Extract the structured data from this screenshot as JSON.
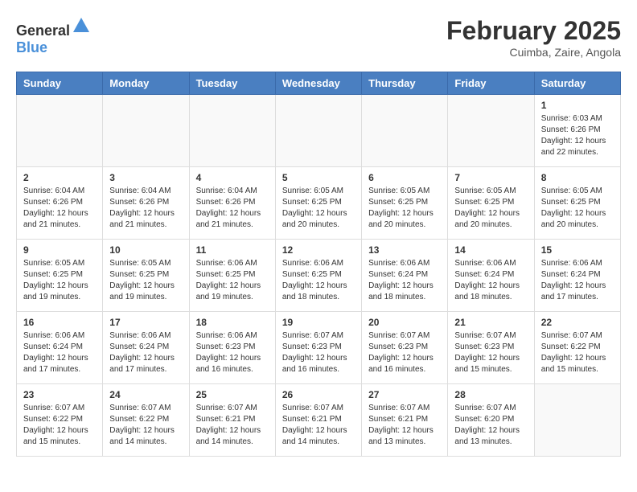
{
  "header": {
    "logo_general": "General",
    "logo_blue": "Blue",
    "month_year": "February 2025",
    "location": "Cuimba, Zaire, Angola"
  },
  "weekdays": [
    "Sunday",
    "Monday",
    "Tuesday",
    "Wednesday",
    "Thursday",
    "Friday",
    "Saturday"
  ],
  "weeks": [
    [
      {
        "day": "",
        "info": ""
      },
      {
        "day": "",
        "info": ""
      },
      {
        "day": "",
        "info": ""
      },
      {
        "day": "",
        "info": ""
      },
      {
        "day": "",
        "info": ""
      },
      {
        "day": "",
        "info": ""
      },
      {
        "day": "1",
        "info": "Sunrise: 6:03 AM\nSunset: 6:26 PM\nDaylight: 12 hours and 22 minutes."
      }
    ],
    [
      {
        "day": "2",
        "info": "Sunrise: 6:04 AM\nSunset: 6:26 PM\nDaylight: 12 hours and 21 minutes."
      },
      {
        "day": "3",
        "info": "Sunrise: 6:04 AM\nSunset: 6:26 PM\nDaylight: 12 hours and 21 minutes."
      },
      {
        "day": "4",
        "info": "Sunrise: 6:04 AM\nSunset: 6:26 PM\nDaylight: 12 hours and 21 minutes."
      },
      {
        "day": "5",
        "info": "Sunrise: 6:05 AM\nSunset: 6:25 PM\nDaylight: 12 hours and 20 minutes."
      },
      {
        "day": "6",
        "info": "Sunrise: 6:05 AM\nSunset: 6:25 PM\nDaylight: 12 hours and 20 minutes."
      },
      {
        "day": "7",
        "info": "Sunrise: 6:05 AM\nSunset: 6:25 PM\nDaylight: 12 hours and 20 minutes."
      },
      {
        "day": "8",
        "info": "Sunrise: 6:05 AM\nSunset: 6:25 PM\nDaylight: 12 hours and 20 minutes."
      }
    ],
    [
      {
        "day": "9",
        "info": "Sunrise: 6:05 AM\nSunset: 6:25 PM\nDaylight: 12 hours and 19 minutes."
      },
      {
        "day": "10",
        "info": "Sunrise: 6:05 AM\nSunset: 6:25 PM\nDaylight: 12 hours and 19 minutes."
      },
      {
        "day": "11",
        "info": "Sunrise: 6:06 AM\nSunset: 6:25 PM\nDaylight: 12 hours and 19 minutes."
      },
      {
        "day": "12",
        "info": "Sunrise: 6:06 AM\nSunset: 6:25 PM\nDaylight: 12 hours and 18 minutes."
      },
      {
        "day": "13",
        "info": "Sunrise: 6:06 AM\nSunset: 6:24 PM\nDaylight: 12 hours and 18 minutes."
      },
      {
        "day": "14",
        "info": "Sunrise: 6:06 AM\nSunset: 6:24 PM\nDaylight: 12 hours and 18 minutes."
      },
      {
        "day": "15",
        "info": "Sunrise: 6:06 AM\nSunset: 6:24 PM\nDaylight: 12 hours and 17 minutes."
      }
    ],
    [
      {
        "day": "16",
        "info": "Sunrise: 6:06 AM\nSunset: 6:24 PM\nDaylight: 12 hours and 17 minutes."
      },
      {
        "day": "17",
        "info": "Sunrise: 6:06 AM\nSunset: 6:24 PM\nDaylight: 12 hours and 17 minutes."
      },
      {
        "day": "18",
        "info": "Sunrise: 6:06 AM\nSunset: 6:23 PM\nDaylight: 12 hours and 16 minutes."
      },
      {
        "day": "19",
        "info": "Sunrise: 6:07 AM\nSunset: 6:23 PM\nDaylight: 12 hours and 16 minutes."
      },
      {
        "day": "20",
        "info": "Sunrise: 6:07 AM\nSunset: 6:23 PM\nDaylight: 12 hours and 16 minutes."
      },
      {
        "day": "21",
        "info": "Sunrise: 6:07 AM\nSunset: 6:23 PM\nDaylight: 12 hours and 15 minutes."
      },
      {
        "day": "22",
        "info": "Sunrise: 6:07 AM\nSunset: 6:22 PM\nDaylight: 12 hours and 15 minutes."
      }
    ],
    [
      {
        "day": "23",
        "info": "Sunrise: 6:07 AM\nSunset: 6:22 PM\nDaylight: 12 hours and 15 minutes."
      },
      {
        "day": "24",
        "info": "Sunrise: 6:07 AM\nSunset: 6:22 PM\nDaylight: 12 hours and 14 minutes."
      },
      {
        "day": "25",
        "info": "Sunrise: 6:07 AM\nSunset: 6:21 PM\nDaylight: 12 hours and 14 minutes."
      },
      {
        "day": "26",
        "info": "Sunrise: 6:07 AM\nSunset: 6:21 PM\nDaylight: 12 hours and 14 minutes."
      },
      {
        "day": "27",
        "info": "Sunrise: 6:07 AM\nSunset: 6:21 PM\nDaylight: 12 hours and 13 minutes."
      },
      {
        "day": "28",
        "info": "Sunrise: 6:07 AM\nSunset: 6:20 PM\nDaylight: 12 hours and 13 minutes."
      },
      {
        "day": "",
        "info": ""
      }
    ]
  ]
}
